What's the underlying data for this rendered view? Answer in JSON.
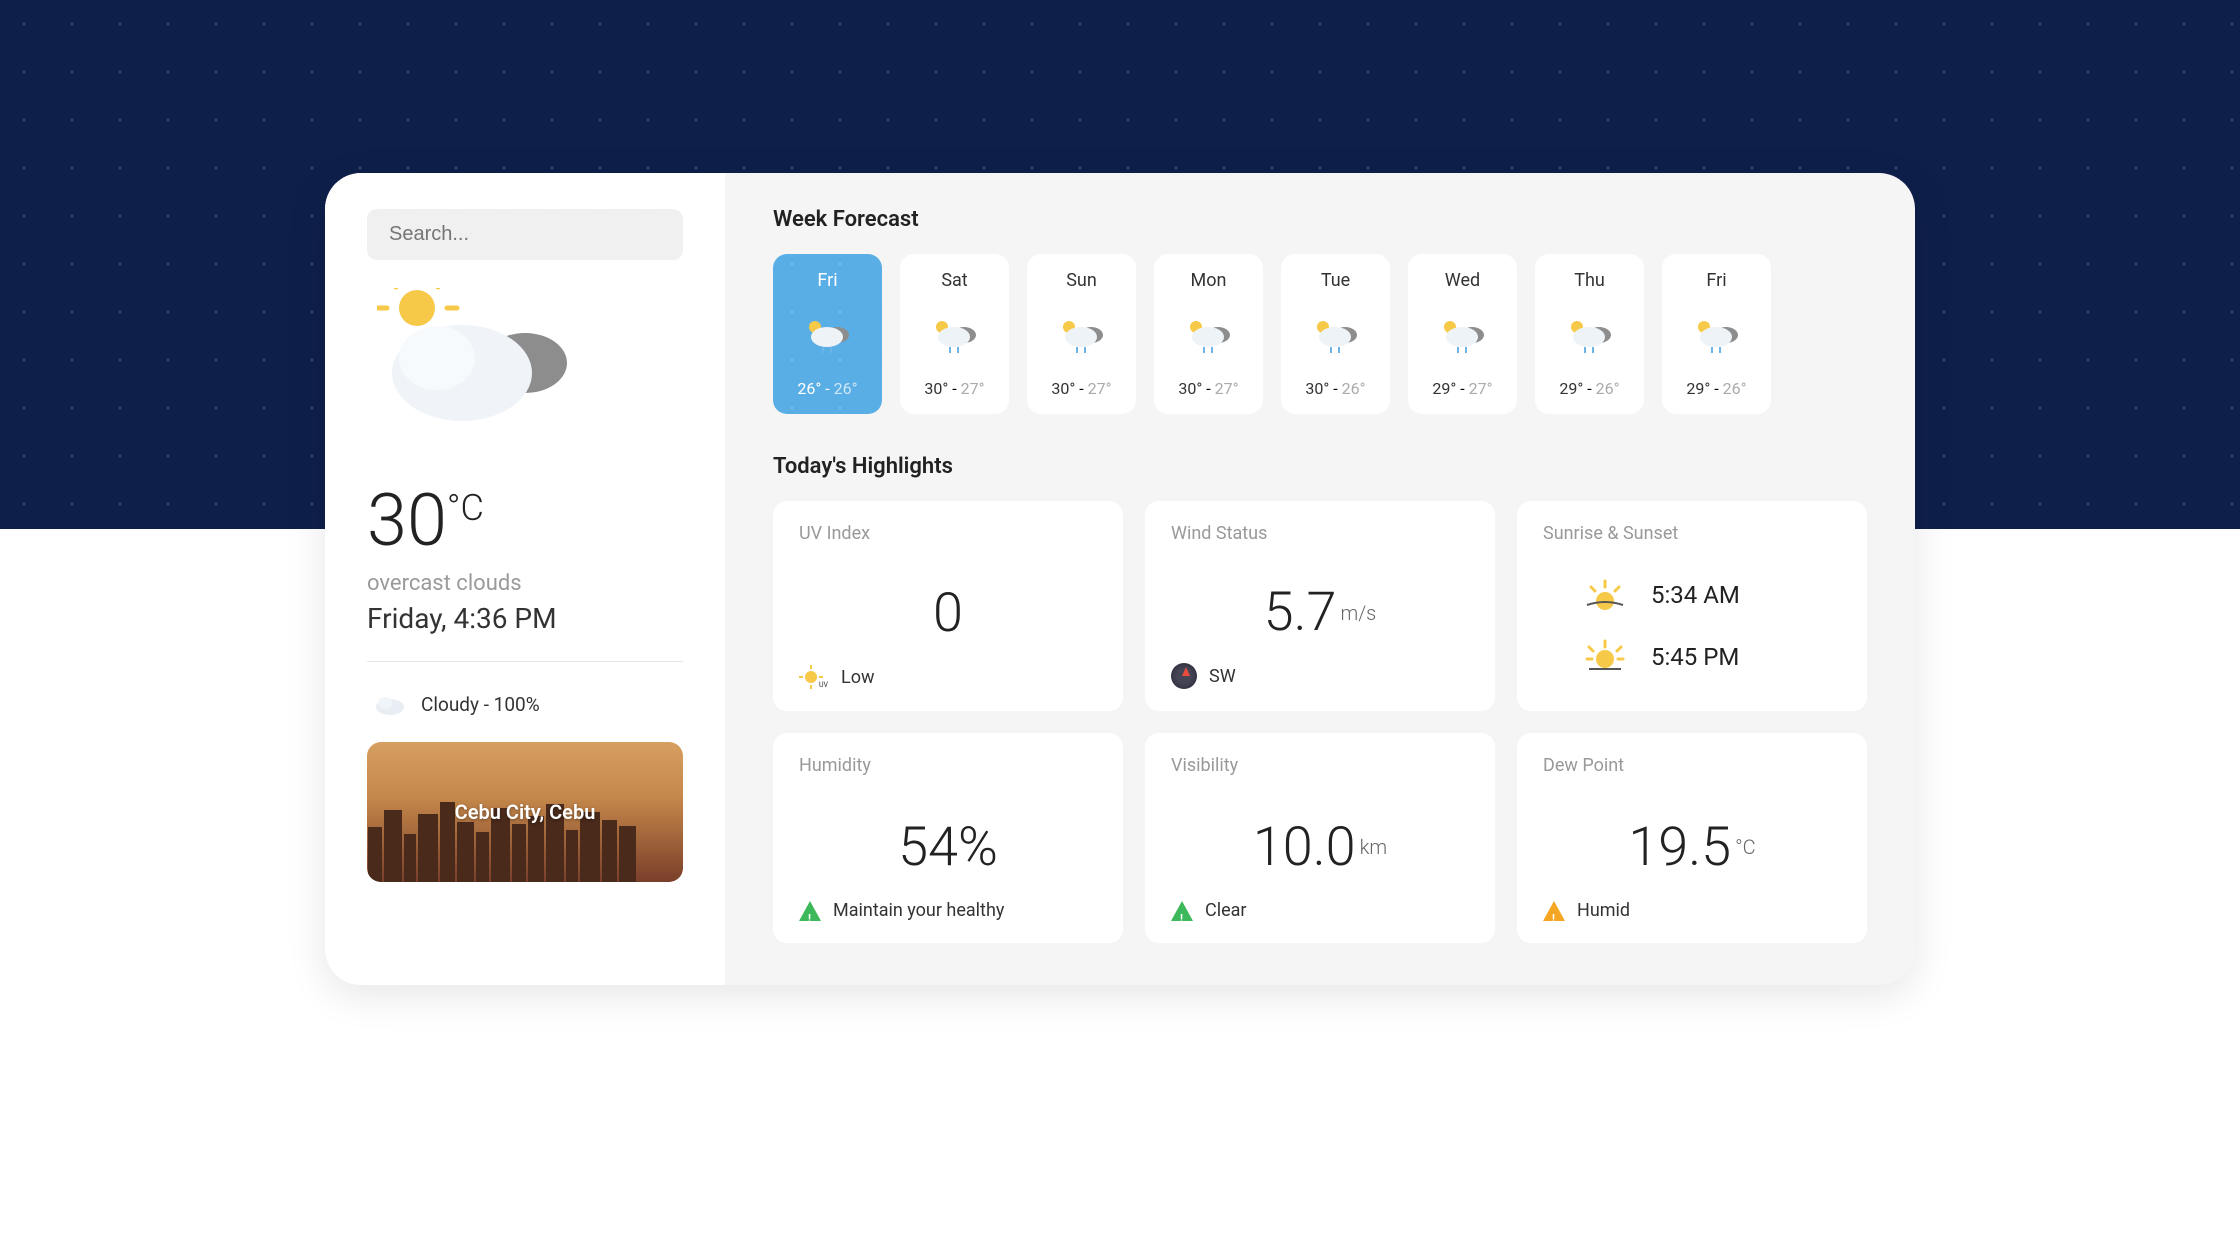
{
  "sidebar": {
    "search_placeholder": "Search...",
    "temperature": "30",
    "temp_unit": "°C",
    "description": "overcast clouds",
    "datetime": "Friday, 4:36 PM",
    "cloud_label": "Cloudy - 100%",
    "city": "Cebu City, Cebu"
  },
  "main": {
    "forecast_title": "Week Forecast",
    "highlights_title": "Today's Highlights",
    "days": [
      {
        "name": "Fri",
        "hi": "26°",
        "lo": "26°",
        "active": true
      },
      {
        "name": "Sat",
        "hi": "30°",
        "lo": "27°",
        "active": false
      },
      {
        "name": "Sun",
        "hi": "30°",
        "lo": "27°",
        "active": false
      },
      {
        "name": "Mon",
        "hi": "30°",
        "lo": "27°",
        "active": false
      },
      {
        "name": "Tue",
        "hi": "30°",
        "lo": "26°",
        "active": false
      },
      {
        "name": "Wed",
        "hi": "29°",
        "lo": "27°",
        "active": false
      },
      {
        "name": "Thu",
        "hi": "29°",
        "lo": "26°",
        "active": false
      },
      {
        "name": "Fri",
        "hi": "29°",
        "lo": "26°",
        "active": false
      }
    ],
    "highlights": {
      "uv": {
        "title": "UV Index",
        "value": "0",
        "status": "Low"
      },
      "wind": {
        "title": "Wind Status",
        "value": "5.7",
        "unit": "m/s",
        "direction": "SW"
      },
      "sun": {
        "title": "Sunrise & Sunset",
        "sunrise": "5:34 AM",
        "sunset": "5:45 PM"
      },
      "humidity": {
        "title": "Humidity",
        "value": "54%",
        "status": "Maintain your healthy"
      },
      "visibility": {
        "title": "Visibility",
        "value": "10.0",
        "unit": "km",
        "status": "Clear"
      },
      "dew": {
        "title": "Dew Point",
        "value": "19.5",
        "unit": "°C",
        "status": "Humid"
      }
    }
  }
}
